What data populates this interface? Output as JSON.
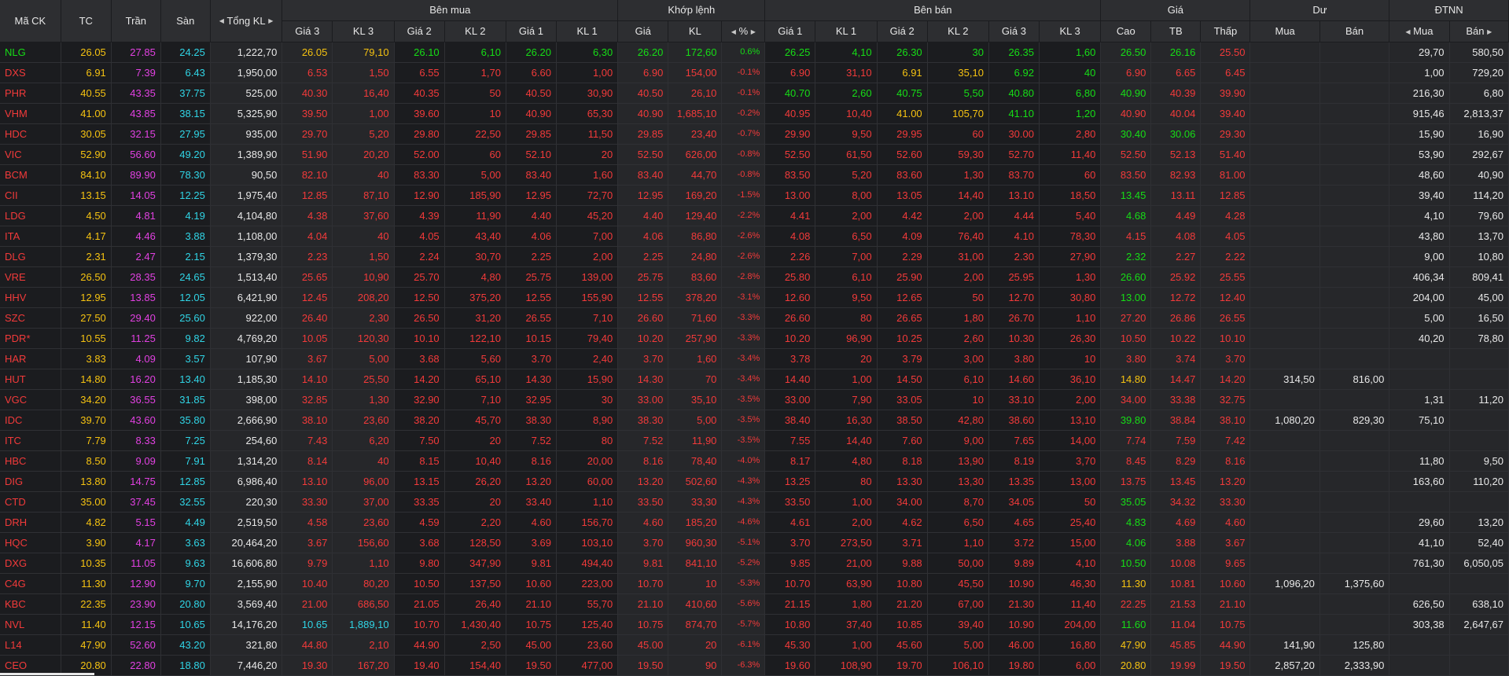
{
  "headers": {
    "symbol": "Mã CK",
    "ref": "TC",
    "ceil": "Trần",
    "floor": "Sàn",
    "total_vol": "Tổng KL",
    "bid_group": "Bên mua",
    "match_group": "Khớp lệnh",
    "ask_group": "Bên bán",
    "price_group": "Giá",
    "pending_group": "Dư",
    "foreign_group": "ĐTNN",
    "bid_sub": [
      "Giá 3",
      "KL 3",
      "Giá 2",
      "KL 2",
      "Giá 1",
      "KL 1"
    ],
    "match_sub": [
      "Giá",
      "KL",
      "%"
    ],
    "ask_sub": [
      "Giá 1",
      "KL 1",
      "Giá 2",
      "KL 2",
      "Giá 3",
      "KL 3"
    ],
    "price_sub": [
      "Cao",
      "TB",
      "Thấp"
    ],
    "pending_sub": [
      "Mua",
      "Bán"
    ],
    "foreign_sub": [
      "Mua",
      "Bán"
    ]
  },
  "icons": {
    "left": "caret-left-icon",
    "right": "caret-right-icon",
    "sort": "sort-down-icon"
  },
  "colors": {
    "up": "#16dd16",
    "down": "#f23a3a",
    "ref": "#f5c211",
    "ceil": "#e241e2",
    "floor": "#30d5e6"
  },
  "rows": [
    [
      "NLG",
      "26.05",
      "27.85",
      "24.25",
      "1,222,70",
      "26.05",
      "79,10",
      "26.10",
      "6,10",
      "26.20",
      "6,30",
      "26.20",
      "172,60",
      "0.6%",
      "26.25",
      "4,10",
      "26.30",
      "30",
      "26.35",
      "1,60",
      "26.50",
      "26.16",
      "25.50",
      "",
      "",
      "29,70",
      "580,50"
    ],
    [
      "DXS",
      "6.91",
      "7.39",
      "6.43",
      "1,950,00",
      "6.53",
      "1,50",
      "6.55",
      "1,70",
      "6.60",
      "1,00",
      "6.90",
      "154,00",
      "-0.1%",
      "6.90",
      "31,10",
      "6.91",
      "35,10",
      "6.92",
      "40",
      "6.90",
      "6.65",
      "6.45",
      "",
      "",
      "1,00",
      "729,20"
    ],
    [
      "PHR",
      "40.55",
      "43.35",
      "37.75",
      "525,00",
      "40.30",
      "16,40",
      "40.35",
      "50",
      "40.50",
      "30,90",
      "40.50",
      "26,10",
      "-0.1%",
      "40.70",
      "2,60",
      "40.75",
      "5,50",
      "40.80",
      "6,80",
      "40.90",
      "40.39",
      "39.90",
      "",
      "",
      "216,30",
      "6,80"
    ],
    [
      "VHM",
      "41.00",
      "43.85",
      "38.15",
      "5,325,90",
      "39.50",
      "1,00",
      "39.60",
      "10",
      "40.90",
      "65,30",
      "40.90",
      "1,685,10",
      "-0.2%",
      "40.95",
      "10,40",
      "41.00",
      "105,70",
      "41.10",
      "1,20",
      "40.90",
      "40.04",
      "39.40",
      "",
      "",
      "915,46",
      "2,813,37"
    ],
    [
      "HDC",
      "30.05",
      "32.15",
      "27.95",
      "935,00",
      "29.70",
      "5,20",
      "29.80",
      "22,50",
      "29.85",
      "11,50",
      "29.85",
      "23,40",
      "-0.7%",
      "29.90",
      "9,50",
      "29.95",
      "60",
      "30.00",
      "2,80",
      "30.40",
      "30.06",
      "29.30",
      "",
      "",
      "15,90",
      "16,90"
    ],
    [
      "VIC",
      "52.90",
      "56.60",
      "49.20",
      "1,389,90",
      "51.90",
      "20,20",
      "52.00",
      "60",
      "52.10",
      "20",
      "52.50",
      "626,00",
      "-0.8%",
      "52.50",
      "61,50",
      "52.60",
      "59,30",
      "52.70",
      "11,40",
      "52.50",
      "52.13",
      "51.40",
      "",
      "",
      "53,90",
      "292,67"
    ],
    [
      "BCM",
      "84.10",
      "89.90",
      "78.30",
      "90,50",
      "82.10",
      "40",
      "83.30",
      "5,00",
      "83.40",
      "1,60",
      "83.40",
      "44,70",
      "-0.8%",
      "83.50",
      "5,20",
      "83.60",
      "1,30",
      "83.70",
      "60",
      "83.50",
      "82.93",
      "81.00",
      "",
      "",
      "48,60",
      "40,90"
    ],
    [
      "CII",
      "13.15",
      "14.05",
      "12.25",
      "1,975,40",
      "12.85",
      "87,10",
      "12.90",
      "185,90",
      "12.95",
      "72,70",
      "12.95",
      "169,20",
      "-1.5%",
      "13.00",
      "8,00",
      "13.05",
      "14,40",
      "13.10",
      "18,50",
      "13.45",
      "13.11",
      "12.85",
      "",
      "",
      "39,40",
      "114,20"
    ],
    [
      "LDG",
      "4.50",
      "4.81",
      "4.19",
      "4,104,80",
      "4.38",
      "37,60",
      "4.39",
      "11,90",
      "4.40",
      "45,20",
      "4.40",
      "129,40",
      "-2.2%",
      "4.41",
      "2,00",
      "4.42",
      "2,00",
      "4.44",
      "5,40",
      "4.68",
      "4.49",
      "4.28",
      "",
      "",
      "4,10",
      "79,60"
    ],
    [
      "ITA",
      "4.17",
      "4.46",
      "3.88",
      "1,108,00",
      "4.04",
      "40",
      "4.05",
      "43,40",
      "4.06",
      "7,00",
      "4.06",
      "86,80",
      "-2.6%",
      "4.08",
      "6,50",
      "4.09",
      "76,40",
      "4.10",
      "78,30",
      "4.15",
      "4.08",
      "4.05",
      "",
      "",
      "43,80",
      "13,70"
    ],
    [
      "DLG",
      "2.31",
      "2.47",
      "2.15",
      "1,379,30",
      "2.23",
      "1,50",
      "2.24",
      "30,70",
      "2.25",
      "2,00",
      "2.25",
      "24,80",
      "-2.6%",
      "2.26",
      "7,00",
      "2.29",
      "31,00",
      "2.30",
      "27,90",
      "2.32",
      "2.27",
      "2.22",
      "",
      "",
      "9,00",
      "10,80"
    ],
    [
      "VRE",
      "26.50",
      "28.35",
      "24.65",
      "1,513,40",
      "25.65",
      "10,90",
      "25.70",
      "4,80",
      "25.75",
      "139,00",
      "25.75",
      "83,60",
      "-2.8%",
      "25.80",
      "6,10",
      "25.90",
      "2,00",
      "25.95",
      "1,30",
      "26.60",
      "25.92",
      "25.55",
      "",
      "",
      "406,34",
      "809,41"
    ],
    [
      "HHV",
      "12.95",
      "13.85",
      "12.05",
      "6,421,90",
      "12.45",
      "208,20",
      "12.50",
      "375,20",
      "12.55",
      "155,90",
      "12.55",
      "378,20",
      "-3.1%",
      "12.60",
      "9,50",
      "12.65",
      "50",
      "12.70",
      "30,80",
      "13.00",
      "12.72",
      "12.40",
      "",
      "",
      "204,00",
      "45,00"
    ],
    [
      "SZC",
      "27.50",
      "29.40",
      "25.60",
      "922,00",
      "26.40",
      "2,30",
      "26.50",
      "31,20",
      "26.55",
      "7,10",
      "26.60",
      "71,60",
      "-3.3%",
      "26.60",
      "80",
      "26.65",
      "1,80",
      "26.70",
      "1,10",
      "27.20",
      "26.86",
      "26.55",
      "",
      "",
      "5,00",
      "16,50"
    ],
    [
      "PDR*",
      "10.55",
      "11.25",
      "9.82",
      "4,769,20",
      "10.05",
      "120,30",
      "10.10",
      "122,10",
      "10.15",
      "79,40",
      "10.20",
      "257,90",
      "-3.3%",
      "10.20",
      "96,90",
      "10.25",
      "2,60",
      "10.30",
      "26,30",
      "10.50",
      "10.22",
      "10.10",
      "",
      "",
      "40,20",
      "78,80"
    ],
    [
      "HAR",
      "3.83",
      "4.09",
      "3.57",
      "107,90",
      "3.67",
      "5,00",
      "3.68",
      "5,60",
      "3.70",
      "2,40",
      "3.70",
      "1,60",
      "-3.4%",
      "3.78",
      "20",
      "3.79",
      "3,00",
      "3.80",
      "10",
      "3.80",
      "3.74",
      "3.70",
      "",
      "",
      "",
      ""
    ],
    [
      "HUT",
      "14.80",
      "16.20",
      "13.40",
      "1,185,30",
      "14.10",
      "25,50",
      "14.20",
      "65,10",
      "14.30",
      "15,90",
      "14.30",
      "70",
      "-3.4%",
      "14.40",
      "1,00",
      "14.50",
      "6,10",
      "14.60",
      "36,10",
      "14.80",
      "14.47",
      "14.20",
      "314,50",
      "816,00",
      "",
      ""
    ],
    [
      "VGC",
      "34.20",
      "36.55",
      "31.85",
      "398,00",
      "32.85",
      "1,30",
      "32.90",
      "7,10",
      "32.95",
      "30",
      "33.00",
      "35,10",
      "-3.5%",
      "33.00",
      "7,90",
      "33.05",
      "10",
      "33.10",
      "2,00",
      "34.00",
      "33.38",
      "32.75",
      "",
      "",
      "1,31",
      "11,20"
    ],
    [
      "IDC",
      "39.70",
      "43.60",
      "35.80",
      "2,666,90",
      "38.10",
      "23,60",
      "38.20",
      "45,70",
      "38.30",
      "8,90",
      "38.30",
      "5,00",
      "-3.5%",
      "38.40",
      "16,30",
      "38.50",
      "42,80",
      "38.60",
      "13,10",
      "39.80",
      "38.84",
      "38.10",
      "1,080,20",
      "829,30",
      "75,10",
      ""
    ],
    [
      "ITC",
      "7.79",
      "8.33",
      "7.25",
      "254,60",
      "7.43",
      "6,20",
      "7.50",
      "20",
      "7.52",
      "80",
      "7.52",
      "11,90",
      "-3.5%",
      "7.55",
      "14,40",
      "7.60",
      "9,00",
      "7.65",
      "14,00",
      "7.74",
      "7.59",
      "7.42",
      "",
      "",
      "",
      ""
    ],
    [
      "HBC",
      "8.50",
      "9.09",
      "7.91",
      "1,314,20",
      "8.14",
      "40",
      "8.15",
      "10,40",
      "8.16",
      "20,00",
      "8.16",
      "78,40",
      "-4.0%",
      "8.17",
      "4,80",
      "8.18",
      "13,90",
      "8.19",
      "3,70",
      "8.45",
      "8.29",
      "8.16",
      "",
      "",
      "11,80",
      "9,50"
    ],
    [
      "DIG",
      "13.80",
      "14.75",
      "12.85",
      "6,986,40",
      "13.10",
      "96,00",
      "13.15",
      "26,20",
      "13.20",
      "60,00",
      "13.20",
      "502,60",
      "-4.3%",
      "13.25",
      "80",
      "13.30",
      "13,30",
      "13.35",
      "13,00",
      "13.75",
      "13.45",
      "13.20",
      "",
      "",
      "163,60",
      "110,20"
    ],
    [
      "CTD",
      "35.00",
      "37.45",
      "32.55",
      "220,30",
      "33.30",
      "37,00",
      "33.35",
      "20",
      "33.40",
      "1,10",
      "33.50",
      "33,30",
      "-4.3%",
      "33.50",
      "1,00",
      "34.00",
      "8,70",
      "34.05",
      "50",
      "35.05",
      "34.32",
      "33.30",
      "",
      "",
      "",
      ""
    ],
    [
      "DRH",
      "4.82",
      "5.15",
      "4.49",
      "2,519,50",
      "4.58",
      "23,60",
      "4.59",
      "2,20",
      "4.60",
      "156,70",
      "4.60",
      "185,20",
      "-4.6%",
      "4.61",
      "2,00",
      "4.62",
      "6,50",
      "4.65",
      "25,40",
      "4.83",
      "4.69",
      "4.60",
      "",
      "",
      "29,60",
      "13,20"
    ],
    [
      "HQC",
      "3.90",
      "4.17",
      "3.63",
      "20,464,20",
      "3.67",
      "156,60",
      "3.68",
      "128,50",
      "3.69",
      "103,10",
      "3.70",
      "960,30",
      "-5.1%",
      "3.70",
      "273,50",
      "3.71",
      "1,10",
      "3.72",
      "15,00",
      "4.06",
      "3.88",
      "3.67",
      "",
      "",
      "41,10",
      "52,40"
    ],
    [
      "DXG",
      "10.35",
      "11.05",
      "9.63",
      "16,606,80",
      "9.79",
      "1,10",
      "9.80",
      "347,90",
      "9.81",
      "494,40",
      "9.81",
      "841,10",
      "-5.2%",
      "9.85",
      "21,00",
      "9.88",
      "50,00",
      "9.89",
      "4,10",
      "10.50",
      "10.08",
      "9.65",
      "",
      "",
      "761,30",
      "6,050,05"
    ],
    [
      "C4G",
      "11.30",
      "12.90",
      "9.70",
      "2,155,90",
      "10.40",
      "80,20",
      "10.50",
      "137,50",
      "10.60",
      "223,00",
      "10.70",
      "10",
      "-5.3%",
      "10.70",
      "63,90",
      "10.80",
      "45,50",
      "10.90",
      "46,30",
      "11.30",
      "10.81",
      "10.60",
      "1,096,20",
      "1,375,60",
      "",
      ""
    ],
    [
      "KBC",
      "22.35",
      "23.90",
      "20.80",
      "3,569,40",
      "21.00",
      "686,50",
      "21.05",
      "26,40",
      "21.10",
      "55,70",
      "21.10",
      "410,60",
      "-5.6%",
      "21.15",
      "1,80",
      "21.20",
      "67,00",
      "21.30",
      "11,40",
      "22.25",
      "21.53",
      "21.10",
      "",
      "",
      "626,50",
      "638,10"
    ],
    [
      "NVL",
      "11.40",
      "12.15",
      "10.65",
      "14,176,20",
      "10.65",
      "1,889,10",
      "10.70",
      "1,430,40",
      "10.75",
      "125,40",
      "10.75",
      "874,70",
      "-5.7%",
      "10.80",
      "37,40",
      "10.85",
      "39,40",
      "10.90",
      "204,00",
      "11.60",
      "11.04",
      "10.75",
      "",
      "",
      "303,38",
      "2,647,67"
    ],
    [
      "L14",
      "47.90",
      "52.60",
      "43.20",
      "321,80",
      "44.80",
      "2,10",
      "44.90",
      "2,50",
      "45.00",
      "23,60",
      "45.00",
      "20",
      "-6.1%",
      "45.30",
      "1,00",
      "45.60",
      "5,00",
      "46.00",
      "16,80",
      "47.90",
      "45.85",
      "44.90",
      "141,90",
      "125,80",
      "",
      ""
    ],
    [
      "CEO",
      "20.80",
      "22.80",
      "18.80",
      "7,446,20",
      "19.30",
      "167,20",
      "19.40",
      "154,40",
      "19.50",
      "477,00",
      "19.50",
      "90",
      "-6.3%",
      "19.60",
      "108,90",
      "19.70",
      "106,10",
      "19.80",
      "6,00",
      "20.80",
      "19.99",
      "19.50",
      "2,857,20",
      "2,333,90",
      "",
      ""
    ]
  ]
}
